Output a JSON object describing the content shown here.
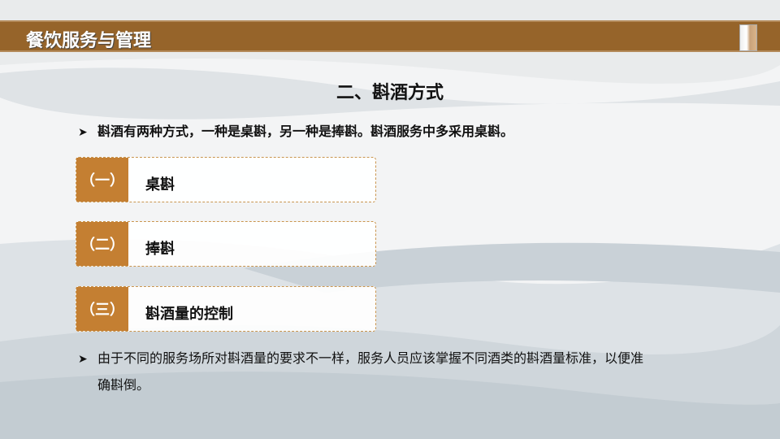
{
  "header": {
    "title": "餐饮服务与管理",
    "logo": "waiter-figures-logo"
  },
  "section_title": "二、斟酒方式",
  "intro": {
    "arrow": "➤",
    "text": "斟酒有两种方式，一种是桌斟，另一种是捧斟。斟酒服务中多采用桌斟。"
  },
  "items": [
    {
      "num": "（一）",
      "label": "桌斟"
    },
    {
      "num": "（二）",
      "label": "捧斟"
    },
    {
      "num": "（三）",
      "label": "斟酒量的控制"
    }
  ],
  "note": {
    "arrow": "➤",
    "line1": "由于不同的服务场所对斟酒量的要求不一样，服务人员应该掌握不同酒类的斟酒量标准，以便准",
    "line2": "确斟倒。"
  },
  "colors": {
    "header": "#96642a",
    "accent": "#c47f32"
  }
}
